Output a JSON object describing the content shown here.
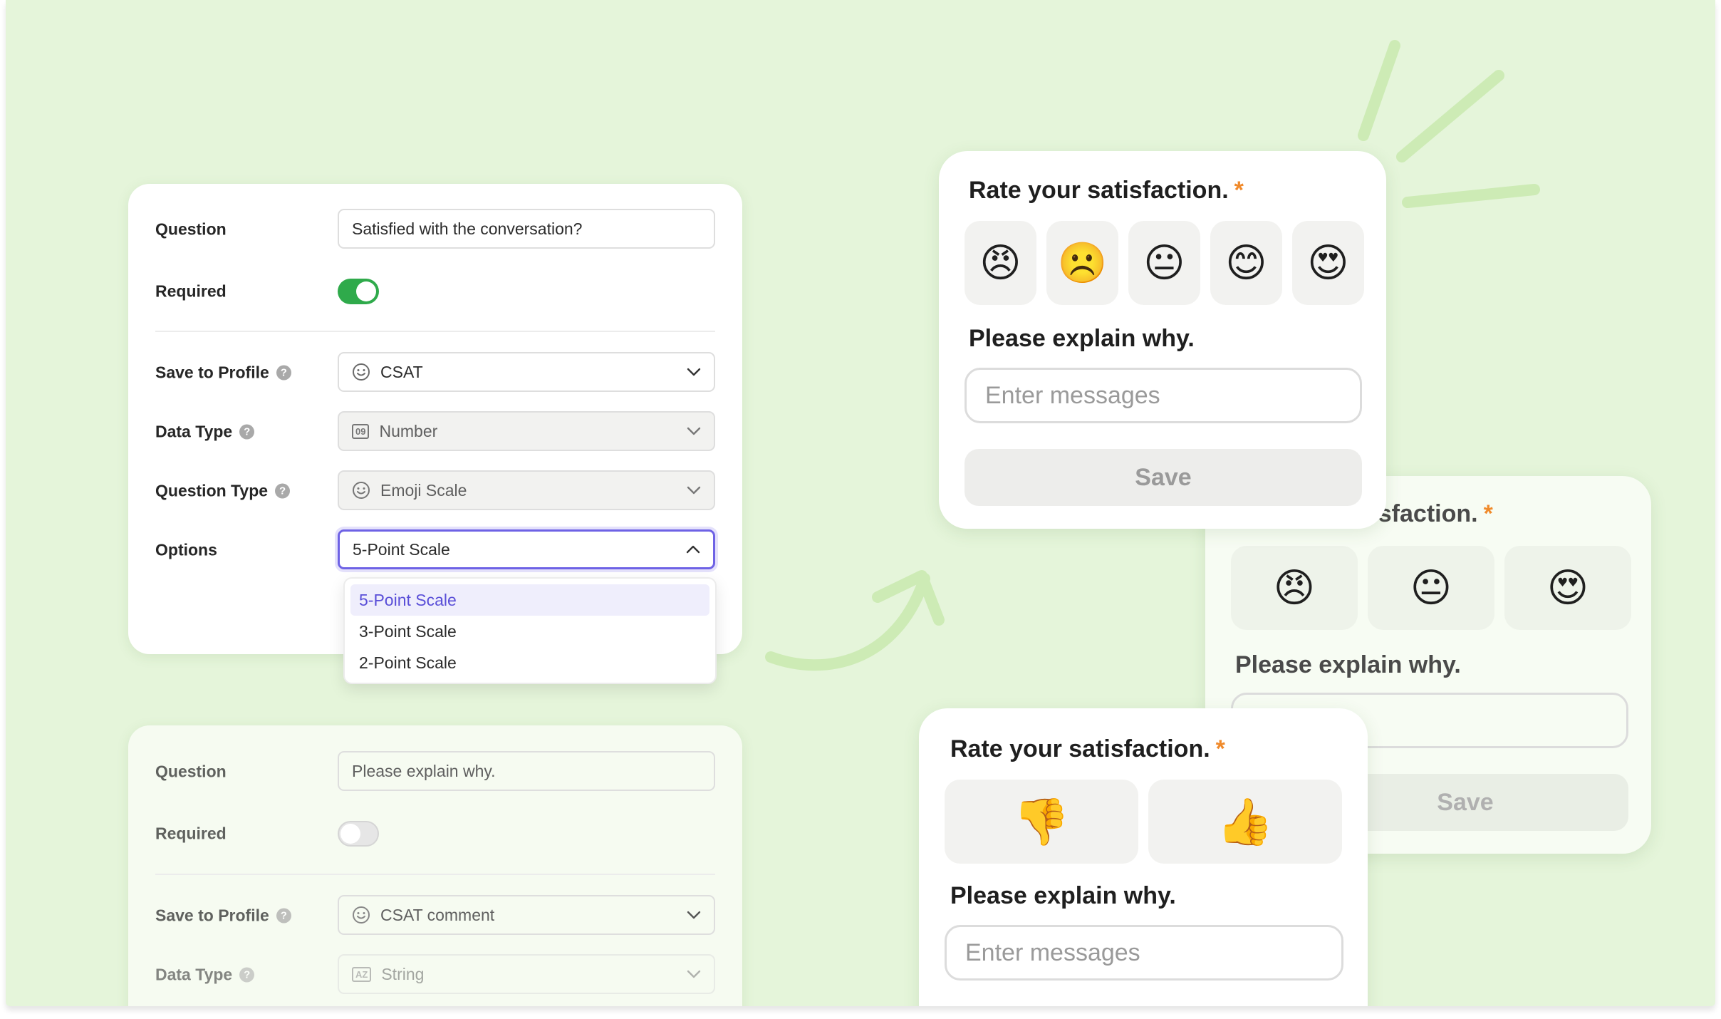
{
  "colors": {
    "background": "#e5f5da",
    "accent": "#6e62e5",
    "toggle_on": "#2faa4b",
    "required_star": "#f08a2b",
    "decoration": "#cdebb5"
  },
  "form1": {
    "question": {
      "label": "Question",
      "value": "Satisfied with the conversation?"
    },
    "required": {
      "label": "Required",
      "on": true
    },
    "save_to_profile": {
      "label": "Save to Profile",
      "value": "CSAT",
      "icon": "smiley-icon"
    },
    "data_type": {
      "label": "Data Type",
      "value": "Number",
      "icon": "number-icon",
      "badge": "09"
    },
    "question_type": {
      "label": "Question Type",
      "value": "Emoji Scale",
      "icon": "smiley-icon"
    },
    "options": {
      "label": "Options",
      "value": "5-Point Scale",
      "items": [
        "5-Point Scale",
        "3-Point Scale",
        "2-Point Scale"
      ]
    },
    "help_symbol": "?"
  },
  "form2": {
    "question": {
      "label": "Question",
      "value": "Please explain why."
    },
    "required": {
      "label": "Required",
      "on": false
    },
    "save_to_profile": {
      "label": "Save to Profile",
      "value": "CSAT comment",
      "icon": "smiley-icon"
    },
    "data_type": {
      "label": "Data Type",
      "value": "String",
      "icon": "text-type-icon",
      "badge": "AZ"
    }
  },
  "survey5": {
    "title": "Rate your satisfaction.",
    "star": "*",
    "emojis": [
      "😠",
      "☹️",
      "😐",
      "😊",
      "😍"
    ],
    "explain": "Please explain why.",
    "placeholder": "Enter messages",
    "button": "Save"
  },
  "survey3": {
    "title_visible": "tisfaction.",
    "star": "*",
    "emojis": [
      "😠",
      "😐",
      "😍"
    ],
    "explain": "Please explain why.",
    "button": "Save"
  },
  "survey2": {
    "title": "Rate your satisfaction.",
    "star": "*",
    "emojis": [
      "👎",
      "👍"
    ],
    "explain": "Please explain why.",
    "placeholder": "Enter messages"
  }
}
